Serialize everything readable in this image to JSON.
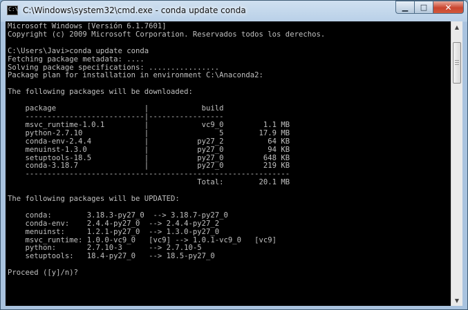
{
  "window": {
    "title": "C:\\Windows\\system32\\cmd.exe - conda  update conda",
    "minimize_label": "▁",
    "maximize_label": "□",
    "close_label": "✕"
  },
  "scrollbar": {
    "up_arrow": "▲",
    "down_arrow": "▼"
  },
  "console": {
    "lines": [
      "Microsoft Windows [Versión 6.1.7601]",
      "Copyright (c) 2009 Microsoft Corporation. Reservados todos los derechos.",
      "",
      "C:\\Users\\Javi>conda update conda",
      "Fetching package metadata: ....",
      "Solving package specifications: ................",
      "Package plan for installation in environment C:\\Anaconda2:",
      "",
      "The following packages will be downloaded:",
      "",
      "    package                    |            build",
      "    ---------------------------|-----------------",
      "    msvc_runtime-1.0.1         |            vc9_0         1.1 MB",
      "    python-2.7.10              |                5        17.9 MB",
      "    conda-env-2.4.4            |           py27_2          64 KB",
      "    menuinst-1.3.0             |           py27_0          94 KB",
      "    setuptools-18.5            |           py27_0         648 KB",
      "    conda-3.18.7               |           py27_0         219 KB",
      "    ------------------------------------------------------------",
      "                                           Total:        20.1 MB",
      "",
      "The following packages will be UPDATED:",
      "",
      "    conda:        3.18.3-py27_0  --> 3.18.7-py27_0",
      "    conda-env:    2.4.4-py27_0  --> 2.4.4-py27_2",
      "    menuinst:     1.2.1-py27_0  --> 1.3.0-py27_0",
      "    msvc_runtime: 1.0.0-vc9_0   [vc9] --> 1.0.1-vc9_0   [vc9]",
      "    python:       2.7.10-3      --> 2.7.10-5",
      "    setuptools:   18.4-py27_0   --> 18.5-py27_0",
      "",
      "Proceed ([y]/n)?"
    ]
  }
}
